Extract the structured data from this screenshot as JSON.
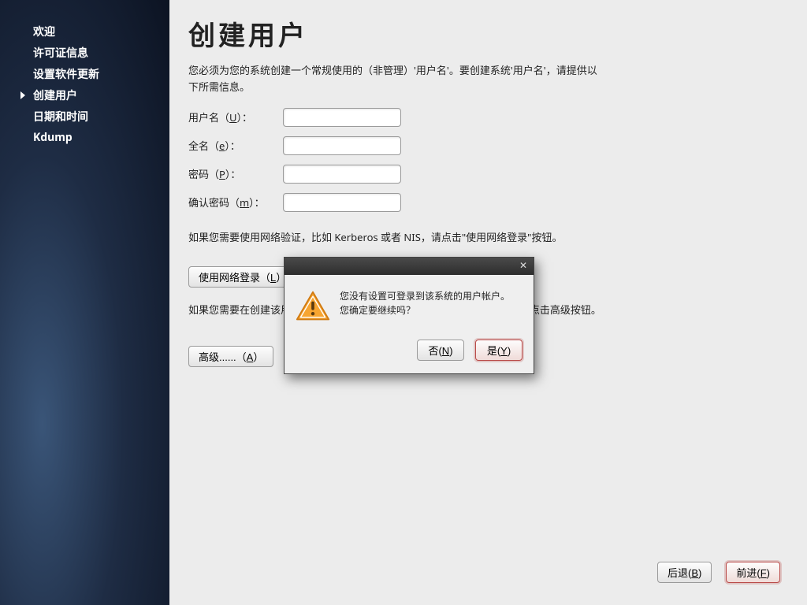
{
  "sidebar": {
    "items": [
      {
        "label": "欢迎"
      },
      {
        "label": "许可证信息"
      },
      {
        "label": "设置软件更新"
      },
      {
        "label": "创建用户"
      },
      {
        "label": "日期和时间"
      },
      {
        "label": "Kdump"
      }
    ],
    "active_index": 3
  },
  "main": {
    "title": "创建用户",
    "description": "您必须为您的系统创建一个常规使用的（非管理）'用户名'。要创建系统'用户名'，请提供以下所需信息。",
    "fields": {
      "username": {
        "label": "用户名（",
        "mn": "U",
        "tail": "）：",
        "value": ""
      },
      "fullname": {
        "label": "全名（",
        "mn": "e",
        "tail": "）：",
        "value": ""
      },
      "password": {
        "label": "密码（",
        "mn": "P",
        "tail": "）：",
        "value": ""
      },
      "confirm": {
        "label": "确认密码（",
        "mn": "m",
        "tail": "）：",
        "value": ""
      }
    },
    "network_note": "如果您需要使用网络验证，比如 Kerberos 或者 NIS，请点击\"使用网络登录\"按钮。",
    "network_login_label": "使用网络登录（",
    "network_login_mn": "L",
    "network_login_tail": "）...",
    "advanced_note": "如果您需要在创建该用户时有更多控制（指定主目录和（／或者）UID），请点击高级按钮。",
    "advanced_label": "高级......（",
    "advanced_mn": "A",
    "advanced_tail": "）",
    "back_label": "后退(",
    "back_mn": "B",
    "back_tail": ")",
    "forward_label": "前进(",
    "forward_mn": "F",
    "forward_tail": ")"
  },
  "dialog": {
    "line1": "您没有设置可登录到该系统的用户帐户。",
    "line2": "您确定要继续吗？",
    "no_label": "否(",
    "no_mn": "N",
    "no_tail": ")",
    "yes_label": "是(",
    "yes_mn": "Y",
    "yes_tail": ")"
  }
}
